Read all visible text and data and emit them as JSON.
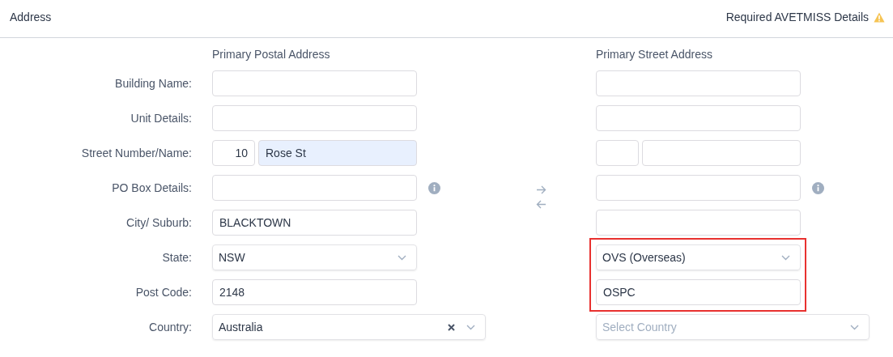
{
  "header": {
    "title": "Address",
    "required_note": "Required AVETMISS Details"
  },
  "columns": [
    "Primary Postal Address",
    "Primary Street Address"
  ],
  "rows": [
    {
      "label": "Building Name:",
      "kind": "text",
      "info": false,
      "postal": {
        "autofilled": false
      },
      "street": {
        "autofilled": false,
        "flagged": false
      }
    },
    {
      "label": "Unit Details:",
      "kind": "text",
      "info": false,
      "postal": {
        "autofilled": false
      },
      "street": {
        "autofilled": false,
        "flagged": false
      }
    },
    {
      "label": "Street Number/Name:",
      "kind": "split",
      "info": false,
      "postal": {
        "parts": [
          {
            "value": "10",
            "autofilled": false
          },
          {
            "value": "Rose St",
            "autofilled": true
          }
        ]
      },
      "street": {
        "parts": [
          {
            "autofilled": false
          },
          {
            "autofilled": false
          }
        ],
        "flagged": false
      }
    },
    {
      "label": "PO Box Details:",
      "kind": "text",
      "info": true,
      "postal": {
        "autofilled": false
      },
      "street": {
        "autofilled": false,
        "flagged": false
      }
    },
    {
      "label": "City/ Suburb:",
      "kind": "text",
      "info": false,
      "postal": {
        "value": "BLACKTOWN",
        "autofilled": false
      },
      "street": {
        "autofilled": false,
        "flagged": false
      }
    },
    {
      "label": "State:",
      "kind": "select",
      "info": false,
      "postal": {
        "value": "NSW"
      },
      "street": {
        "value": "OVS (Overseas)",
        "flagged": true
      }
    },
    {
      "label": "Post Code:",
      "kind": "text",
      "info": false,
      "postal": {
        "value": "2148",
        "autofilled": false
      },
      "street": {
        "value": "OSPC",
        "autofilled": false,
        "flagged": true
      }
    },
    {
      "label": "Country:",
      "kind": "country",
      "info": false,
      "postal": {
        "value": "Australia"
      },
      "street": {
        "placeholder": "Select Country",
        "flagged": false
      }
    }
  ]
}
